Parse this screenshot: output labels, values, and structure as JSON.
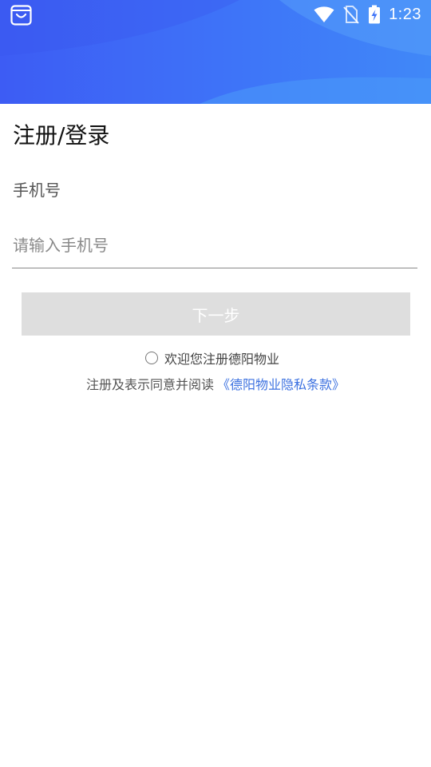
{
  "status_bar": {
    "time": "1:23",
    "icons": [
      "app-bag-icon",
      "wifi-icon",
      "no-sim-icon",
      "battery-charging-icon"
    ]
  },
  "header": {
    "colors": {
      "gradient_start": "#3d5cf4",
      "gradient_end": "#4088f8"
    }
  },
  "form": {
    "title": "注册/登录",
    "phone_label": "手机号",
    "phone_placeholder": "请输入手机号",
    "phone_value": "",
    "next_button_label": "下一步",
    "agree_label": "欢迎您注册德阳物业",
    "agree_checked": false,
    "terms_prefix": "注册及表示同意并阅读",
    "terms_link": "《德阳物业隐私条款》"
  },
  "colors": {
    "link": "#3c71e0",
    "button_disabled": "#dedede"
  }
}
